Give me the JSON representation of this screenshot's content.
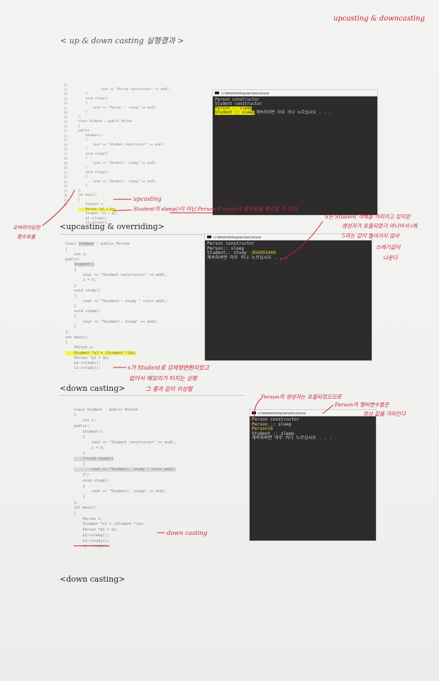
{
  "header": {
    "top_right_note": "upcasting & downcasting",
    "title": "< up & down casting 실행결과 >"
  },
  "section1": {
    "line_numbers": "12\n13\n14\n15\n16\n17\n18\n19\n20\n21\n22\n23\n24\n25\n26\n27\n28\n29\n30\n31\n32\n33\n34\n35\n36\n37\n38",
    "code_before": "        cout << \"Person constructor\" << endl;\n    }\n    void sleep()\n    {\n        cout << \"Person :: sleep\" << endl;\n    }\n};\nclass Student : public Person\n{\npublic:\n    Student()\n    {\n        cout << \"Student constructor\" << endl;\n    }\n    void study()\n    {\n        cout << \"Student:: study\" << endl;\n    }\n    void sleep()\n    {\n        cout << \"Student:: sleep\" << endl;\n    }\n};\nint main()\n{\n    Student s;",
    "code_hl": "    Person *p1 = &s;",
    "code_after": "    Student *s1 = &s;\n    p1->sleep();\n    s1->sleep();",
    "console_title": "C:\\WINDOWS\\system32\\cmd.exe",
    "console_l1": "Person constructor",
    "console_l2": "Student constructor",
    "console_hl1": "Person :: sleep",
    "console_hl2": "Student :: sleep",
    "console_l3": "계속하려면 아무 키나 누르십시오 . . .",
    "note_upcasting": "upcasting",
    "note_arrow": "Student의 sleep()이 아닌 Person의 sleep이 출력됨을 확인할 수 있다.",
    "side_note_1": "오버라이딩된",
    "side_note_2": "함수호출"
  },
  "section2": {
    "heading": "<upcasting & overriding>",
    "line_numbers": "\n\n\n\n\n\n\n\n\n\n\n\n\n\n\n\n\n\n\n\n\n\n\n\n\n",
    "code_head1": "class ",
    "code_head_hl": "Student",
    "code_head2": " : public Person\n{\n    int i;\npublic:\n    ",
    "code_ctor": "Student()",
    "code_body": "\n    {\n        cout << \"Student constructor\" << endl;\n        i = 5;\n    }\n    void study()\n    {\n        cout << \"Student:: study \" <<i<< endl;\n    }\n    void sleep()\n    {\n        cout << \"Student:: sleep\" << endl;\n    }\n};\nint main()\n{\n    Person s;",
    "code_hl": "    Student *s1 = (Student *)&s;",
    "code_after": "    Person *p1 = &s;\n    p1->sleep();\n    s1->study();",
    "console_title": "C:\\WINDOWS\\system32\\cmd.exe",
    "console_l1": "Person constructor",
    "console_l2": "Person:: sleep",
    "console_l3a": "Student:: study ",
    "console_l3b": "-858993460",
    "console_l4": "계속하려면 아무 키나 누르십시오 . . .",
    "note_right_1": "S는 Student 객체를 가리키고 있지만",
    "note_right_2": "생성자가 호출되었기 아니어서 i에",
    "note_right_3": "5라는 값이 들어가지 않아",
    "note_right_4": "쓰레기값이",
    "note_right_5": "나온다",
    "note_mid_1": "s가 Student로 강제형변환되었고",
    "note_mid_2": "없어서 메모리가 터지는 상황",
    "note_mid_3": "그 결과 값이 이상함"
  },
  "section3": {
    "heading": "<down casting>",
    "code_before": "class Student : public Person\n{\n    int i;\npublic:\n    Student()\n    {\n        cout << \"Student constructor\" << endl;\n        i = 5;\n    }",
    "code_gray1": "    /*void study()",
    "code_mid": "    {",
    "code_gray2": "        cout << \"Student:: study \" <<i<< endl;",
    "code_mid2": "    }*/\n    void sleep()\n    {\n        cout << \"Student:: sleep\" << endl;\n    }\n};\nint main()\n{\n    Person s;\n    Student *s1 = (Student *)&s;\n    Person *p1 = &s;\n    p1->sleep();\n    s1->study();",
    "code_strike": "    s1->sleep();",
    "console_title": "C:\\WINDOWS\\system32\\cmd.exe",
    "console_l1": "Person constructor",
    "console_l2": "Person :: sleep",
    "console_hl": "Person10",
    "console_l3": "Student :: sleep",
    "console_l4": "계속하려면 아무 키나 누르십시오 . . .",
    "note_downcast": "down casting",
    "note_top_1": "Person의 생성자는 호출되었으므로",
    "note_top_2": "Person의 멤버변수들은",
    "note_top_3": "정상 값을 가리킨다"
  },
  "section4": {
    "heading": "<down casting>"
  }
}
